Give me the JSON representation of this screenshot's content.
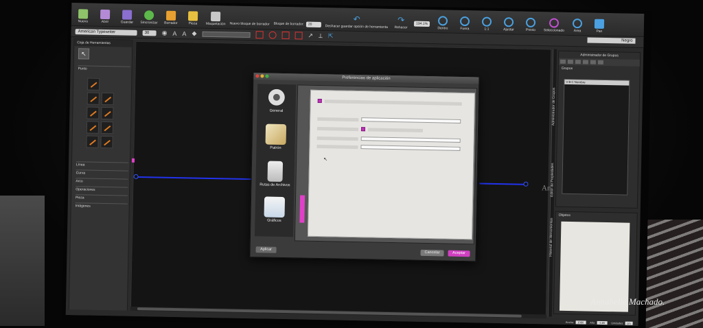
{
  "toolbar": {
    "items": [
      {
        "label": "Nuevo",
        "icon": "new-file-icon",
        "color": "#8fc46a"
      },
      {
        "label": "Abrir",
        "icon": "open-file-icon",
        "color": "#b48ad6"
      },
      {
        "label": "Guardar",
        "icon": "save-icon",
        "color": "#8a6fd0"
      },
      {
        "label": "Sincronizar",
        "icon": "sync-icon",
        "color": "#5cb84a"
      },
      {
        "label": "Borrador",
        "icon": "eraser-icon",
        "color": "#e8a030"
      },
      {
        "label": "Pieza",
        "icon": "piece-icon",
        "color": "#e8c040"
      },
      {
        "label": "Maquetación",
        "icon": "layout-icon",
        "color": "#c8c8c8"
      }
    ],
    "block_label": "Nuevo bloque de borrador",
    "eraser_width_label": "Bloque de borrador:",
    "eraser_width_value": "20",
    "undo_label": "Deshacer guardar opción de herramienta",
    "redo_label": "Rehacer",
    "zoom_value": "194.1%",
    "zoom_items": [
      {
        "label": "Dentro",
        "icon": "zoom-in-icon"
      },
      {
        "label": "Fuera",
        "icon": "zoom-out-icon"
      },
      {
        "label": "1:1",
        "icon": "zoom-actual-icon"
      },
      {
        "label": "Ajustar",
        "icon": "zoom-fit-icon"
      },
      {
        "label": "Previo",
        "icon": "zoom-previous-icon"
      },
      {
        "label": "Seleccionado",
        "icon": "zoom-selection-icon"
      },
      {
        "label": "Área",
        "icon": "zoom-area-icon"
      },
      {
        "label": "Pan",
        "icon": "pan-icon"
      }
    ]
  },
  "toolbar2": {
    "font": "American Typewriter",
    "size": "30",
    "group_select": "Negro"
  },
  "toolbox": {
    "title": "Caja de Herramientas",
    "sections": [
      "Punto",
      "Línea",
      "Curva",
      "Arco",
      "Operaciones",
      "Pieza",
      "Imágenes"
    ]
  },
  "canvas": {
    "label_text": "An"
  },
  "group_manager": {
    "title": "Administrador de Grupos",
    "groups_label": "Grupos",
    "columns": [
      "V",
      "B",
      "C",
      "Nombre"
    ],
    "vtab_1": "Administrador de Grupos",
    "vtab_2": "Editor de Propiedades",
    "vtab_3": "Historial de Herramientas"
  },
  "objects": {
    "label": "Objetos"
  },
  "statusbar": {
    "fields": [
      {
        "label": "Ancho:",
        "value": "1080"
      },
      {
        "label": "Alto:",
        "value": "-4.80"
      },
      {
        "label": "Unidades:",
        "value": "cm"
      }
    ]
  },
  "dialog": {
    "title": "Preferencias de aplicación",
    "categories": [
      {
        "label": "General",
        "icon": "gear-icon"
      },
      {
        "label": "Patrón",
        "icon": "pattern-icon"
      },
      {
        "label": "Rutas de Archivos",
        "icon": "file-paths-icon"
      },
      {
        "label": "Gráficos",
        "icon": "graphics-icon"
      }
    ],
    "apply_label": "Aplicar",
    "cancel_label": "Cancelar",
    "accept_label": "Aceptar"
  },
  "watermark": "Annabelle Machado."
}
